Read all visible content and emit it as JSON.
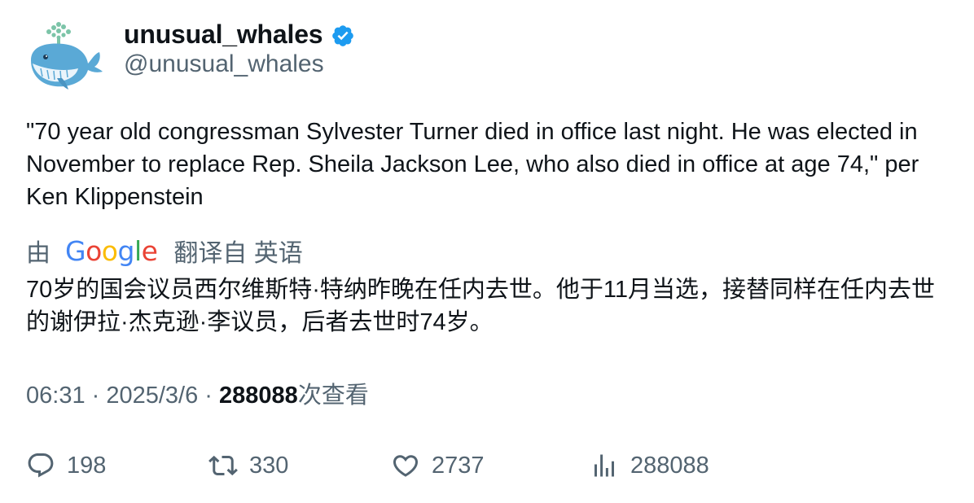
{
  "author": {
    "display_name": "unusual_whales",
    "handle": "@unusual_whales",
    "verified": true,
    "avatar_icon": "whale-avatar-icon",
    "verified_color": "#1d9bf0"
  },
  "tweet": {
    "text": "\"70 year old congressman Sylvester Turner died in office last night. He was elected in November to replace Rep. Sheila Jackson Lee, who also died in office at age 74,\" per Ken Klippenstein"
  },
  "translation": {
    "by_label": "由",
    "provider": "Google",
    "source_label": "翻译自 英语",
    "text": "70岁的国会议员西尔维斯特·特纳昨晚在任内去世。他于11月当选，接替同样在任内去世的谢伊拉·杰克逊·李议员，后者去世时74岁。"
  },
  "meta": {
    "time": "06:31",
    "separator": " · ",
    "date": "2025/3/6",
    "views_count": "288088",
    "views_label": "次查看"
  },
  "actions": {
    "replies": "198",
    "retweets": "330",
    "likes": "2737",
    "views": "288088"
  },
  "colors": {
    "text_primary": "#0f1419",
    "text_secondary": "#536471",
    "accent": "#1d9bf0"
  }
}
